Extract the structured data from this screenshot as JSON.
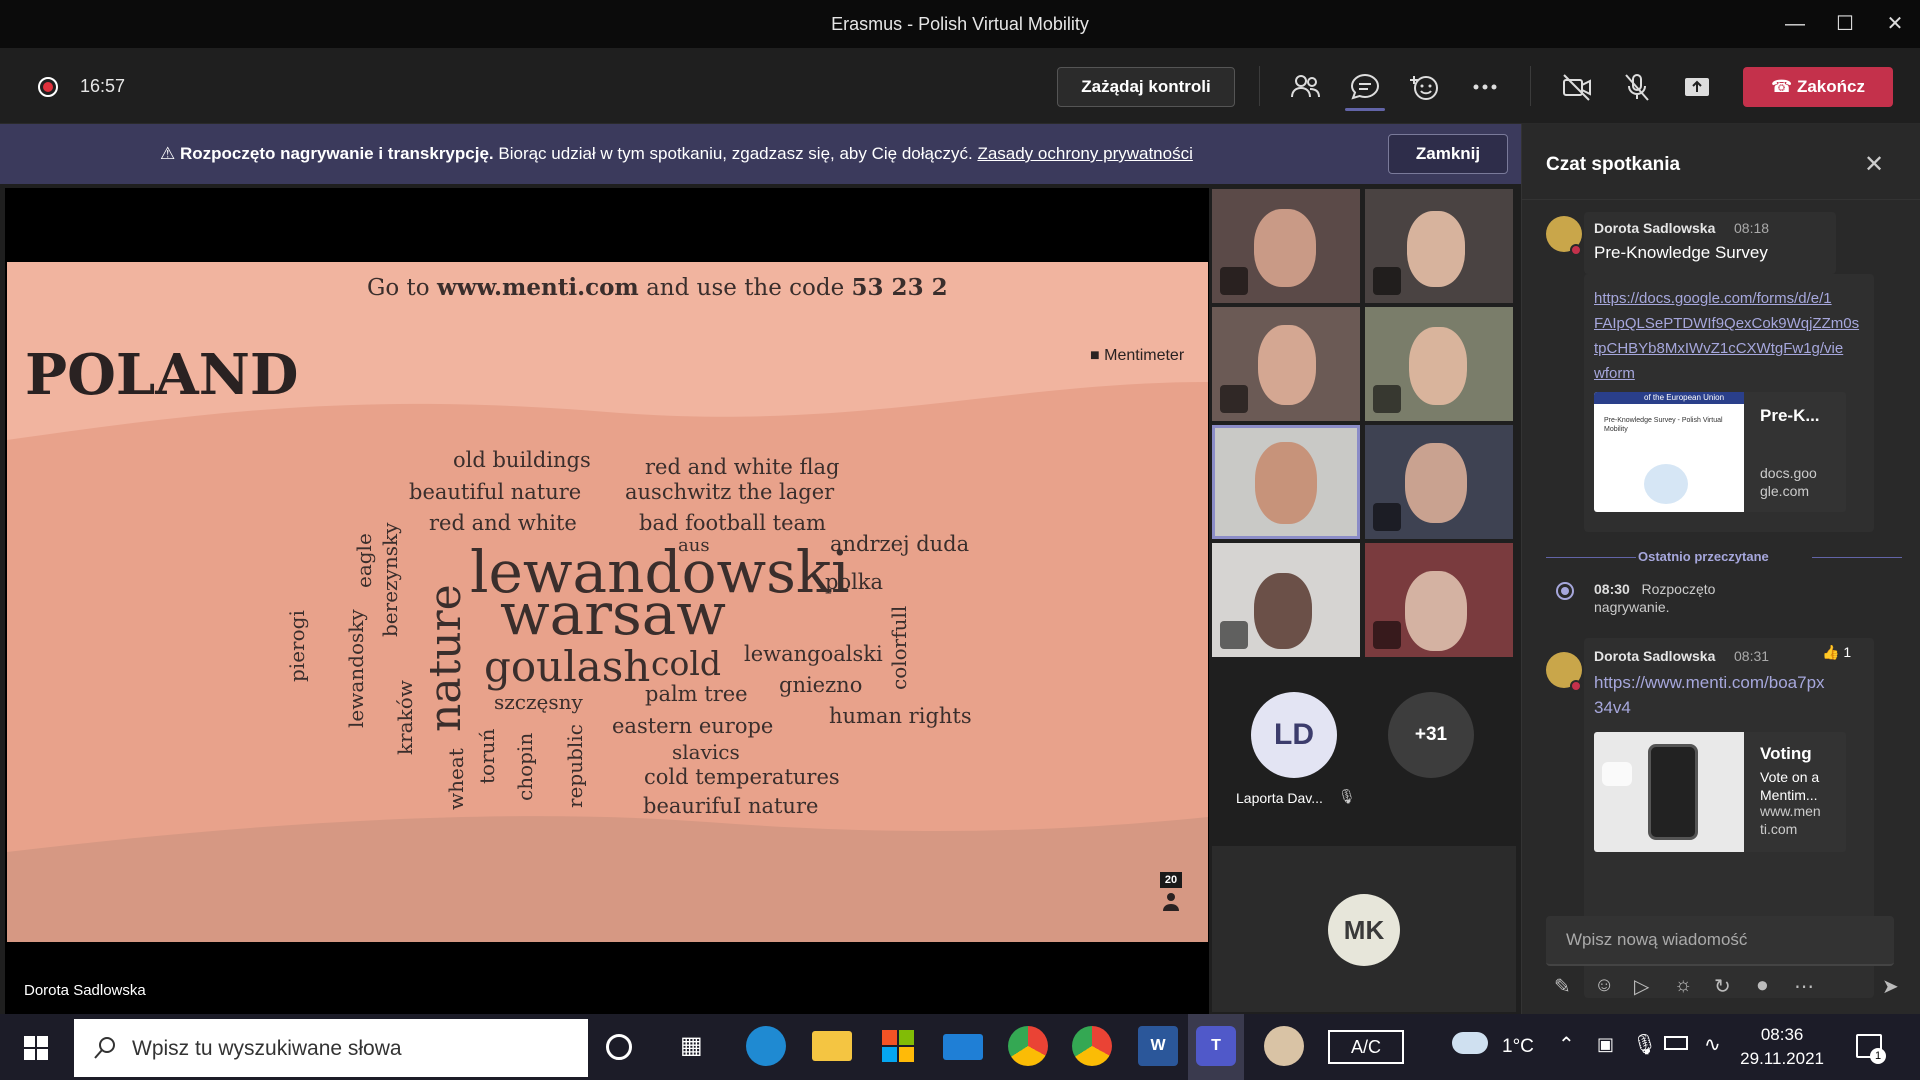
{
  "window": {
    "title": "Erasmus - Polish Virtual Mobility"
  },
  "toolbar": {
    "timer": "16:57",
    "request_control_label": "Zażądaj kontroli",
    "end_label": "Zakończ"
  },
  "banner": {
    "bold_text": "Rozpoczęto nagrywanie i transkrypcję.",
    "text": "Biorąc udział w tym spotkaniu, zgadzasz się, aby Cię dołączyć.",
    "link_text": "Zasady ochrony prywatności",
    "close_label": "Zamknij"
  },
  "slide": {
    "instruction_pre": "Go to",
    "instruction_site": "www.menti.com",
    "instruction_mid": "and use the code",
    "instruction_code": "53 23 2",
    "heading": "POLAND",
    "brand": "Mentimeter",
    "response_count": "20",
    "words": [
      "old buildings",
      "red and white flag",
      "beautiful nature",
      "auschwitz the lager",
      "red and white",
      "bad football team",
      "aus",
      "andrzej duda",
      "lewandowski",
      "polka",
      "warsaw",
      "goulash",
      "cold",
      "lewangoalski",
      "gniezno",
      "palm tree",
      "szczęsny",
      "human rights",
      "eastern europe",
      "slavics",
      "cold temperatures",
      "beaurifuI nature",
      "pierogi",
      "eagle",
      "lewandosky",
      "berezynsky",
      "nature",
      "kraków",
      "wheat",
      "toruń",
      "chopin",
      "republic",
      "colorfull"
    ]
  },
  "stage": {
    "presenter_name": "Dorota Sadlowska"
  },
  "participants": {
    "ld_initials": "LD",
    "ld_name": "Laporta Dav...",
    "overflow_count": "+31",
    "mk_initials": "MK"
  },
  "chat": {
    "title": "Czat spotkania",
    "msg1": {
      "sender": "Dorota Sadlowska",
      "time": "08:18",
      "text": "Pre-Knowledge Survey",
      "link": "https://docs.google.com/forms/d/e/1FAIpQLSePTDWIf9QexCok9WqjZZm0stpCHBYb8MxIWvZ1cCXWtgFw1g/viewform",
      "link_lines": [
        "https://docs.google.com/forms/d/e/1",
        "FAIpQLSePTDWIf9QexCok9WqjZZm0s",
        "tpCHBYb8MxIWvZ1cCXWtgFw1g/vie",
        "wform"
      ],
      "card_title": "Pre-K...",
      "card_domain_lines": [
        "docs.goo",
        "gle.com"
      ],
      "card_thumb_header": "of the European Union",
      "card_thumb_title": "Pre-Knowledge Survey - Polish Virtual Mobility"
    },
    "last_read": "Ostatnio przeczytane",
    "system": {
      "time": "08:30",
      "text_line1": "Rozpoczęto",
      "text_line2": "nagrywanie."
    },
    "msg2": {
      "sender": "Dorota Sadlowska",
      "time": "08:31",
      "reaction_count": "1",
      "link_lines": [
        "https://www.menti.com/boa7px",
        "34v4"
      ],
      "card_title": "Voting",
      "card_desc_lines": [
        "Vote on a",
        "Mentim..."
      ],
      "card_domain_lines": [
        "www.men",
        "ti.com"
      ]
    },
    "compose_placeholder": "Wpisz nową wiadomość"
  },
  "taskbar": {
    "search_placeholder": "Wpisz tu wyszukiwane słowa",
    "ac_label": "A/C",
    "temperature": "1°C",
    "time": "08:36",
    "date": "29.11.2021",
    "notification_count": "1"
  },
  "colors": {
    "brand_purple": "#6264a7",
    "end_call_red": "#c4314b",
    "slide_background": "#f1b49f",
    "banner_background": "#3b3a5c"
  }
}
